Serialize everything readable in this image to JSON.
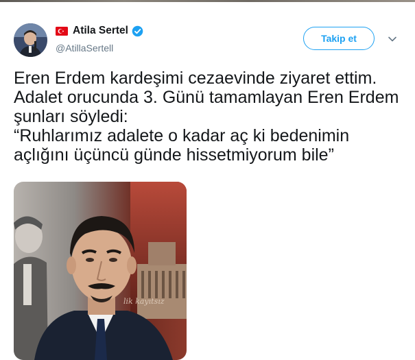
{
  "tweet": {
    "author": {
      "display_name": "Atila Sertel",
      "handle": "@AtillaSertell",
      "verified": true,
      "flag_icon": "turkey-flag-icon"
    },
    "follow_label": "Takip et",
    "menu_icon": "chevron-down-icon",
    "text": "Eren Erdem kardeşimi cezaevinde ziyaret ettim. Adalet orucunda 3. Günü tamamlayan Eren Erdem şunları söyledi:\n“Ruhlarımız adalete o kadar aç ki bedenimin açlığını üçüncü günde hissetmiyorum bile”",
    "media": {
      "type": "photo",
      "description_icon": "photo-portrait"
    }
  },
  "colors": {
    "accent": "#1da1f2",
    "text": "#14171a",
    "secondary_text": "#657786",
    "flag_red": "#e30a17"
  }
}
